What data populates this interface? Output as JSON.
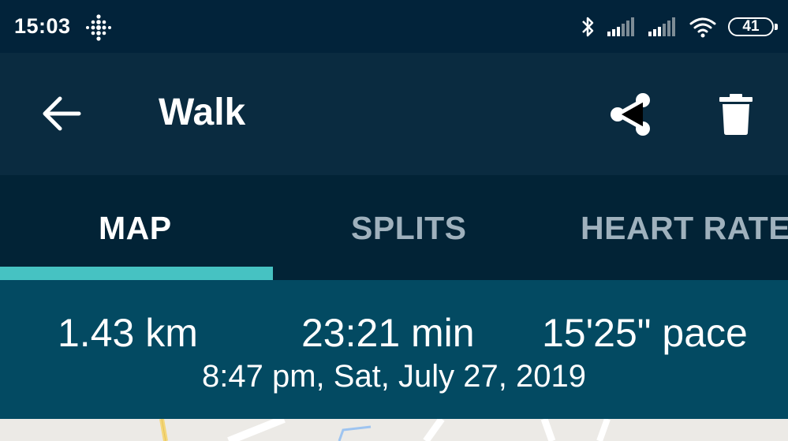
{
  "status_bar": {
    "time": "15:03",
    "battery": "41",
    "icons": [
      "fitbit-icon",
      "bluetooth-icon",
      "signal-icon",
      "signal-icon",
      "wifi-icon",
      "battery-icon"
    ]
  },
  "app_bar": {
    "title": "Walk",
    "icons": [
      "back-arrow-icon",
      "share-icon",
      "trash-icon"
    ]
  },
  "tabs": [
    {
      "label": "MAP",
      "active": true
    },
    {
      "label": "SPLITS",
      "active": false
    },
    {
      "label": "HEART RATE",
      "active": false
    }
  ],
  "summary": {
    "distance": "1.43 km",
    "duration": "23:21 min",
    "pace": "15'25\" pace",
    "date": "8:47 pm, Sat, July 27, 2019"
  },
  "colors": {
    "status_bg": "#02233a",
    "app_bar_bg": "#0a2b40",
    "tabs_bg": "#022336",
    "tab_indicator": "#46c2c2",
    "stats_bg": "#034a62",
    "map_bg": "#eceae6"
  }
}
